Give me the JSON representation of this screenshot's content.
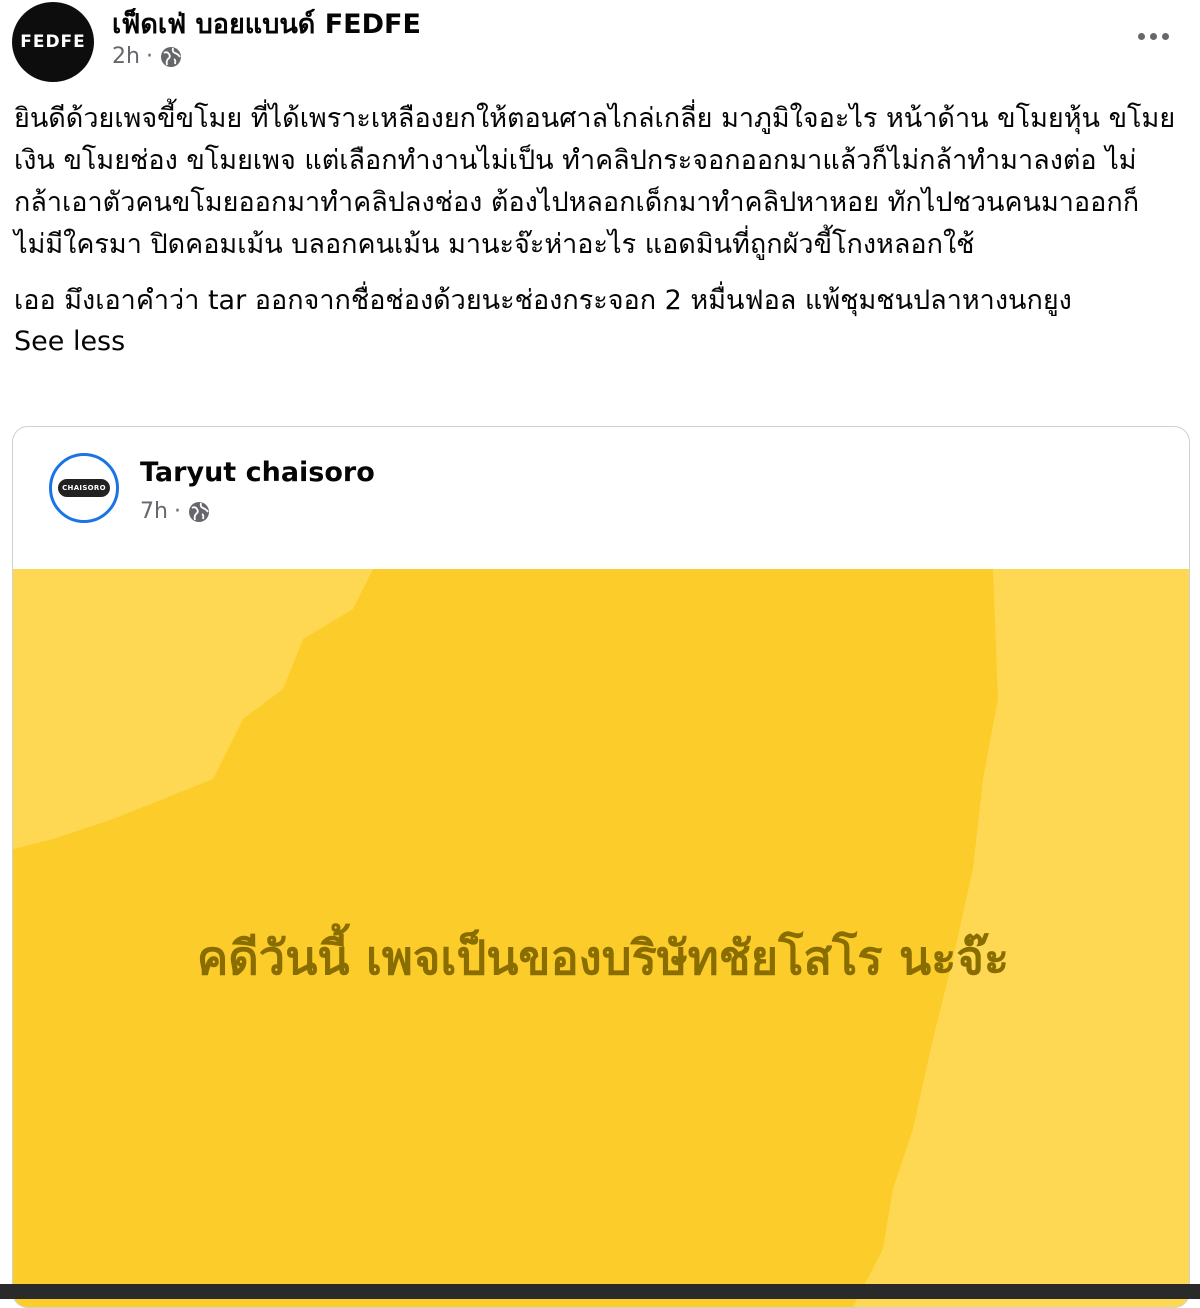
{
  "post": {
    "page_name": "เฟ็ดเฟ่ บอยแบนด์ FEDFE",
    "avatar_text": "FEDFE",
    "time": "2h",
    "separator": "·",
    "audience_icon": "globe-icon",
    "more_icon": "more-options-icon",
    "body_paragraph_1": "ยินดีด้วยเพจขี้ขโมย ที่ได้เพราะเหลืองยกให้ตอนศาลไกล่เกลี่ย  มาภูมิใจอะไร หน้าด้าน ขโมยหุ้น ขโมยเงิน ขโมยช่อง ขโมยเพจ แต่เลือกทำงานไม่เป็น ทำคลิปกระจอกออกมาแล้วก็ไม่กล้าทำมาลงต่อ ไม่กล้าเอาตัวคนขโมยออกมาทำคลิปลงช่อง ต้องไปหลอกเด็กมาทำคลิปหาหอย ทักไปชวนคนมาออกก็ไม่มีใครมา ปิดคอมเม้น บลอกคนเม้น มานะจ๊ะห่าอะไร แอดมินที่ถูกผัวขี้โกงหลอกใช้",
    "body_paragraph_2": "เออ มึงเอาคำว่า tar ออกจากชื่อช่องด้วยนะช่องกระจอก 2 หมื่นฟอล แพ้ชุมชนปลาหางนกยูง",
    "see_less": "See less"
  },
  "shared": {
    "author_name": "Taryut chaisoro",
    "avatar_text": "CHAISORO",
    "time": "7h",
    "separator": "·",
    "audience_icon": "globe-icon",
    "status_text": "คดีวันนี้ เพจเป็นของบริษัทชัยโสโร นะจ๊ะ",
    "background_color": "#ffd23f",
    "text_color": "#8a6d00"
  }
}
